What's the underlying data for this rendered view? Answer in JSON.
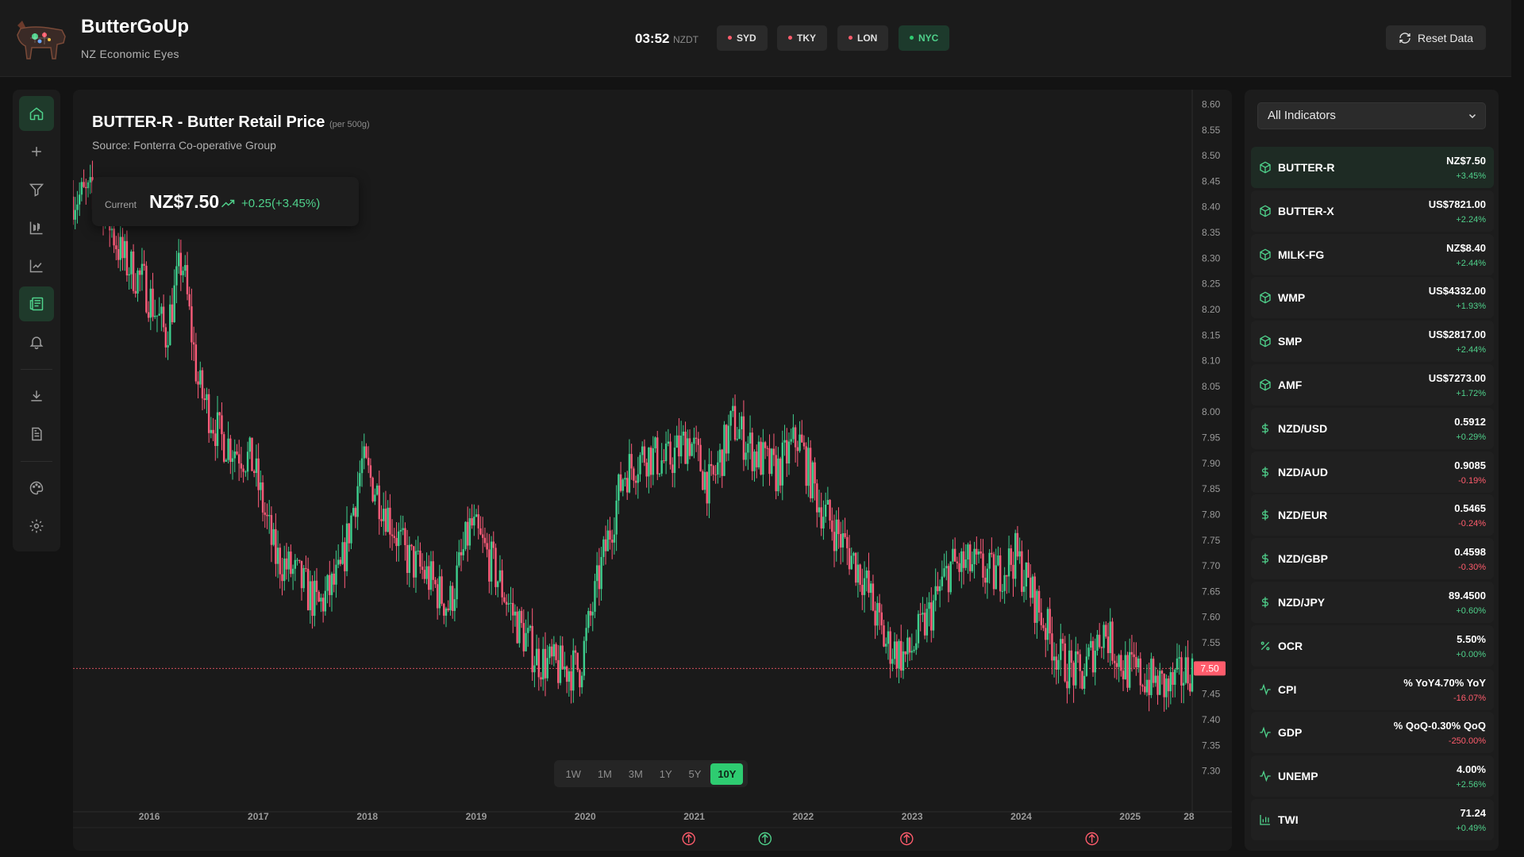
{
  "app": {
    "name": "ButterGoUp",
    "subtitle": "NZ Economic Eyes"
  },
  "clock": {
    "time": "03:52",
    "zone": "NZDT"
  },
  "markets": [
    {
      "label": "SYD",
      "status": "closed"
    },
    {
      "label": "TKY",
      "status": "closed"
    },
    {
      "label": "LON",
      "status": "closed"
    },
    {
      "label": "NYC",
      "status": "open"
    }
  ],
  "reset_label": "Reset Data",
  "colors": {
    "up": "#4fd18b",
    "down": "#ff5c6c",
    "accent": "#2ecc71",
    "closed_dot": "#ff5c6c",
    "open_dot": "#2ecc71"
  },
  "sidebar": {
    "icons": [
      "home-icon",
      "plus-icon",
      "filter-icon",
      "candles-icon",
      "line-chart-icon",
      "news-icon",
      "bell-icon",
      "download-icon",
      "document-icon",
      "palette-icon",
      "settings-icon"
    ],
    "active": "news-icon"
  },
  "chart": {
    "title": "BUTTER-R - Butter Retail Price",
    "unit": "(per 500g)",
    "source": "Source: Fonterra Co-operative Group",
    "current_label": "Current",
    "current_value": "NZ$7.50",
    "current_change": "+0.25(+3.45%)",
    "ranges": [
      "1W",
      "1M",
      "3M",
      "1Y",
      "5Y",
      "10Y"
    ],
    "selected_range": "10Y"
  },
  "chart_data": {
    "type": "candlestick",
    "title": "BUTTER-R - Butter Retail Price",
    "ylim": [
      7.27,
      8.61
    ],
    "y_ticks": [
      "8.60",
      "8.55",
      "8.50",
      "8.45",
      "8.40",
      "8.35",
      "8.30",
      "8.25",
      "8.20",
      "8.15",
      "8.10",
      "8.05",
      "8.00",
      "7.95",
      "7.90",
      "7.85",
      "7.80",
      "7.75",
      "7.70",
      "7.65",
      "7.60",
      "7.55",
      "7.50",
      "7.45",
      "7.40",
      "7.35",
      "7.30"
    ],
    "x_ticks": [
      "2016",
      "2017",
      "2018",
      "2019",
      "2020",
      "2021",
      "2022",
      "2023",
      "2024",
      "2025",
      "28"
    ],
    "current_price_label": "7.50",
    "current_price": 7.5,
    "x": [
      2015.6,
      2015.8,
      2016.0,
      2016.2,
      2016.35,
      2016.5,
      2016.7,
      2016.9,
      2017.0,
      2017.2,
      2017.4,
      2017.6,
      2017.8,
      2018.0,
      2018.2,
      2018.4,
      2018.6,
      2018.8,
      2019.0,
      2019.2,
      2019.4,
      2019.6,
      2019.8,
      2020.0,
      2020.2,
      2020.4,
      2020.6,
      2020.8,
      2021.0,
      2021.2,
      2021.4,
      2021.6,
      2021.8,
      2022.0,
      2022.2,
      2022.4,
      2022.6,
      2022.8,
      2023.0,
      2023.2,
      2023.4,
      2023.6,
      2023.8,
      2024.0,
      2024.2,
      2024.4,
      2024.6,
      2024.8,
      2025.0,
      2025.2,
      2025.4,
      2025.6
    ],
    "close": [
      8.42,
      8.3,
      8.25,
      8.15,
      8.3,
      8.05,
      7.95,
      7.92,
      7.9,
      7.72,
      7.68,
      7.62,
      7.68,
      7.9,
      7.82,
      7.72,
      7.68,
      7.62,
      7.78,
      7.7,
      7.6,
      7.52,
      7.5,
      7.5,
      7.7,
      7.88,
      7.92,
      7.9,
      7.95,
      7.85,
      7.98,
      7.92,
      7.88,
      7.95,
      7.82,
      7.75,
      7.68,
      7.55,
      7.52,
      7.6,
      7.7,
      7.7,
      7.68,
      7.72,
      7.62,
      7.52,
      7.48,
      7.58,
      7.5,
      7.48,
      7.46,
      7.5
    ],
    "markers": [
      {
        "x": 2021.0,
        "dir": "up",
        "color": "#ff5c6c"
      },
      {
        "x": 2021.7,
        "dir": "up",
        "color": "#4fd18b"
      },
      {
        "x": 2023.0,
        "dir": "up",
        "color": "#ff5c6c"
      },
      {
        "x": 2024.7,
        "dir": "up",
        "color": "#ff5c6c"
      }
    ]
  },
  "panel": {
    "filter": "All Indicators",
    "items": [
      {
        "sym": "BUTTER-R",
        "val": "NZ$7.50",
        "chg": "+3.45%",
        "dir": "up",
        "icon": "box-icon"
      },
      {
        "sym": "BUTTER-X",
        "val": "US$7821.00",
        "chg": "+2.24%",
        "dir": "up",
        "icon": "box-icon"
      },
      {
        "sym": "MILK-FG",
        "val": "NZ$8.40",
        "chg": "+2.44%",
        "dir": "up",
        "icon": "box-icon"
      },
      {
        "sym": "WMP",
        "val": "US$4332.00",
        "chg": "+1.93%",
        "dir": "up",
        "icon": "box-icon"
      },
      {
        "sym": "SMP",
        "val": "US$2817.00",
        "chg": "+2.44%",
        "dir": "up",
        "icon": "box-icon"
      },
      {
        "sym": "AMF",
        "val": "US$7273.00",
        "chg": "+1.72%",
        "dir": "up",
        "icon": "box-icon"
      },
      {
        "sym": "NZD/USD",
        "val": "0.5912",
        "chg": "+0.29%",
        "dir": "up",
        "icon": "dollar-icon"
      },
      {
        "sym": "NZD/AUD",
        "val": "0.9085",
        "chg": "-0.19%",
        "dir": "down",
        "icon": "dollar-icon"
      },
      {
        "sym": "NZD/EUR",
        "val": "0.5465",
        "chg": "-0.24%",
        "dir": "down",
        "icon": "dollar-icon"
      },
      {
        "sym": "NZD/GBP",
        "val": "0.4598",
        "chg": "-0.30%",
        "dir": "down",
        "icon": "dollar-icon"
      },
      {
        "sym": "NZD/JPY",
        "val": "89.4500",
        "chg": "+0.60%",
        "dir": "up",
        "icon": "dollar-icon"
      },
      {
        "sym": "OCR",
        "val": "5.50%",
        "chg": "+0.00%",
        "dir": "up",
        "icon": "percent-icon"
      },
      {
        "sym": "CPI",
        "val": "% YoY4.70% YoY",
        "chg": "-16.07%",
        "dir": "down",
        "icon": "pulse-icon"
      },
      {
        "sym": "GDP",
        "val": "% QoQ-0.30% QoQ",
        "chg": "-250.00%",
        "dir": "down",
        "icon": "pulse-icon"
      },
      {
        "sym": "UNEMP",
        "val": "4.00%",
        "chg": "+2.56%",
        "dir": "up",
        "icon": "pulse-icon"
      },
      {
        "sym": "TWI",
        "val": "71.24",
        "chg": "+0.49%",
        "dir": "up",
        "icon": "bars-icon"
      }
    ]
  }
}
